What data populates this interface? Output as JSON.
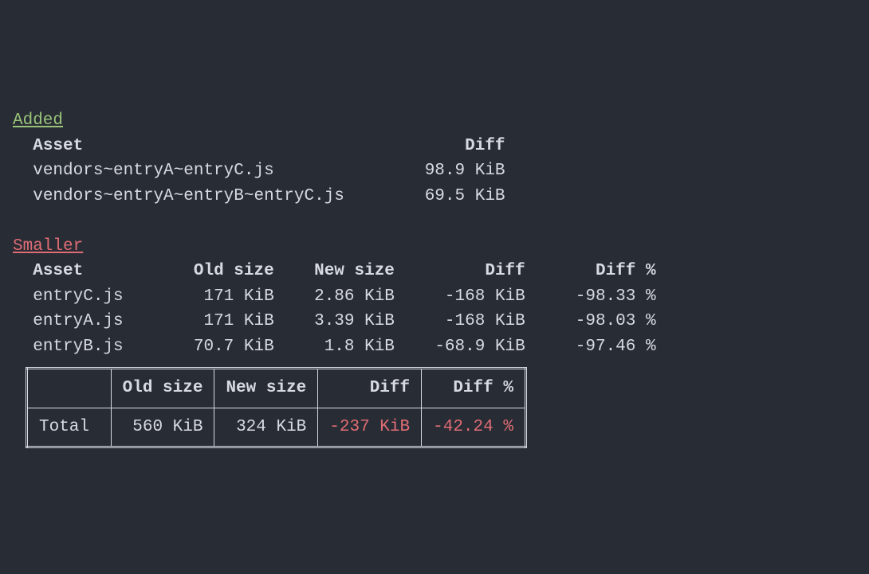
{
  "added": {
    "heading": "Added",
    "header_asset": "Asset",
    "header_diff": "Diff",
    "rows": [
      {
        "asset": "vendors~entryA~entryC.js",
        "diff": "98.9 KiB"
      },
      {
        "asset": "vendors~entryA~entryB~entryC.js",
        "diff": "69.5 KiB"
      }
    ]
  },
  "smaller": {
    "heading": "Smaller",
    "header_asset": "Asset",
    "header_oldsize": "Old size",
    "header_newsize": "New size",
    "header_diff": "Diff",
    "header_diffpct": "Diff %",
    "rows": [
      {
        "asset": "entryC.js",
        "old": "171 KiB",
        "new": "2.86 KiB",
        "diff": "-168 KiB",
        "diffpct": "-98.33 %"
      },
      {
        "asset": "entryA.js",
        "old": "171 KiB",
        "new": "3.39 KiB",
        "diff": "-168 KiB",
        "diffpct": "-98.03 %"
      },
      {
        "asset": "entryB.js",
        "old": "70.7 KiB",
        "new": "1.8 KiB",
        "diff": "-68.9 KiB",
        "diffpct": "-97.46 %"
      }
    ]
  },
  "summary": {
    "header_oldsize": "Old size",
    "header_newsize": "New size",
    "header_diff": "Diff",
    "header_diffpct": "Diff %",
    "row_label": "Total",
    "old": "560 KiB",
    "new": "324 KiB",
    "diff": "-237 KiB",
    "diffpct": "-42.24 %"
  }
}
